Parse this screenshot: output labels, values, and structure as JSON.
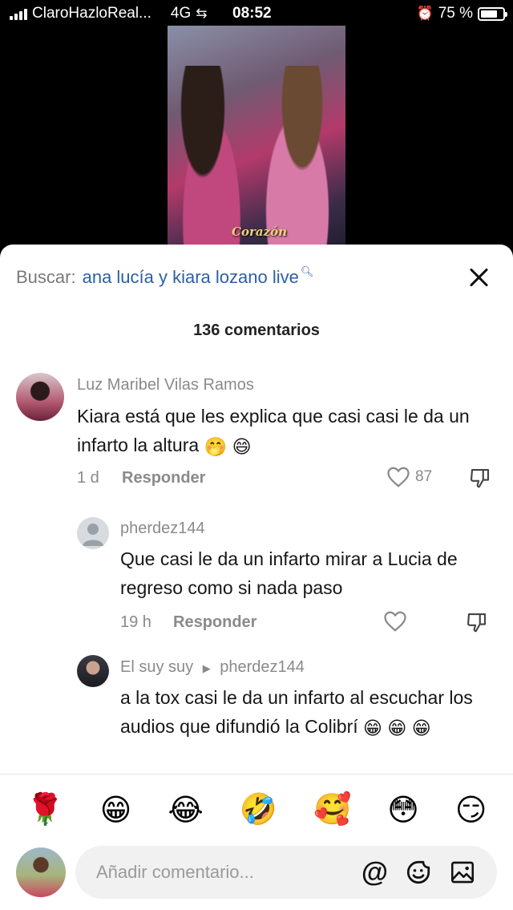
{
  "status_bar": {
    "carrier": "ClaroHazloReal...",
    "network": "4G",
    "time": "08:52",
    "battery": "75 %"
  },
  "video": {
    "caption": "Corazón"
  },
  "search": {
    "label": "Buscar:",
    "query": "ana lucía y kiara lozano live"
  },
  "comments_count": "136 comentarios",
  "comments": [
    {
      "author": "Luz Maribel Vilas Ramos",
      "text": "Kiara está que les explica que casi casi le da un infarto la altura",
      "emojis": [
        "🤭",
        "😄"
      ],
      "age": "1 d",
      "reply_label": "Responder",
      "likes": "87"
    },
    {
      "author": "pherdez144",
      "text": "Que casi le da un infarto mirar a Lucia de regreso como si nada paso",
      "age": "19 h",
      "reply_label": "Responder"
    },
    {
      "author": "El suy suy",
      "reply_to": "pherdez144",
      "text": "a la tox casi le da un infarto al escuchar los audios que difundió la Colibrí",
      "emojis": [
        "😁",
        "😁",
        "😁"
      ]
    }
  ],
  "quick_emojis": [
    "🌹",
    "😁",
    "😂",
    "🤣",
    "🥰",
    "😳",
    "😏"
  ],
  "composer": {
    "placeholder": "Añadir comentario..."
  },
  "colors": {
    "link": "#2b5fa8",
    "muted": "#8a8a8a",
    "sheet_bg": "#ffffff"
  }
}
